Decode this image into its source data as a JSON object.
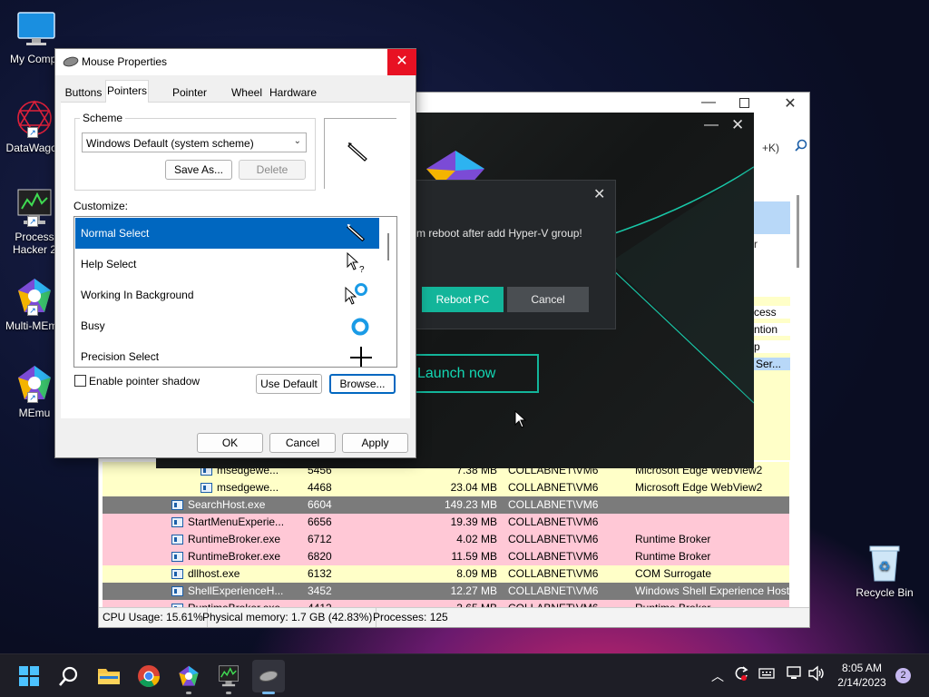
{
  "desktop": {
    "icons": [
      {
        "label": "My Compu"
      },
      {
        "label": "DataWagon"
      },
      {
        "label": "Process Hacker 2"
      },
      {
        "label": "Multi-MEmu"
      },
      {
        "label": "MEmu"
      },
      {
        "label": "Recycle Bin"
      }
    ]
  },
  "process_hacker": {
    "search_hint": "+K)",
    "partial_labels": [
      "r",
      "cess",
      "ntion",
      "p",
      "Ser..."
    ],
    "rows": [
      {
        "name": "msedgewe...",
        "pid": "5456",
        "memory": "7.38 MB",
        "user": "COLLABNET\\VM6",
        "desc": "Microsoft Edge WebView2",
        "bg": "#ffffc8",
        "indent": true
      },
      {
        "name": "msedgewe...",
        "pid": "4468",
        "memory": "23.04 MB",
        "user": "COLLABNET\\VM6",
        "desc": "Microsoft Edge WebView2",
        "bg": "#ffffc8",
        "indent": true
      },
      {
        "name": "SearchHost.exe",
        "pid": "6604",
        "memory": "149.23 MB",
        "user": "COLLABNET\\VM6",
        "desc": "",
        "bg": "#7b7b7b",
        "indent": false
      },
      {
        "name": "StartMenuExperie...",
        "pid": "6656",
        "memory": "19.39 MB",
        "user": "COLLABNET\\VM6",
        "desc": "",
        "bg": "#ffc8d6",
        "indent": false
      },
      {
        "name": "RuntimeBroker.exe",
        "pid": "6712",
        "memory": "4.02 MB",
        "user": "COLLABNET\\VM6",
        "desc": "Runtime Broker",
        "bg": "#ffc8d6",
        "indent": false
      },
      {
        "name": "RuntimeBroker.exe",
        "pid": "6820",
        "memory": "11.59 MB",
        "user": "COLLABNET\\VM6",
        "desc": "Runtime Broker",
        "bg": "#ffc8d6",
        "indent": false
      },
      {
        "name": "dllhost.exe",
        "pid": "6132",
        "memory": "8.09 MB",
        "user": "COLLABNET\\VM6",
        "desc": "COM Surrogate",
        "bg": "#ffffc8",
        "indent": false
      },
      {
        "name": "ShellExperienceH...",
        "pid": "3452",
        "memory": "12.27 MB",
        "user": "COLLABNET\\VM6",
        "desc": "Windows Shell Experience Host",
        "bg": "#7b7b7b",
        "indent": false
      },
      {
        "name": "RuntimeBroker.exe",
        "pid": "4412",
        "memory": "3.65 MB",
        "user": "COLLABNET\\VM6",
        "desc": "Runtime Broker",
        "bg": "#ffc8d6",
        "indent": false
      }
    ],
    "status": {
      "cpu": "CPU Usage: 15.61%",
      "memory": "Physical memory: 1.7 GB (42.83%)",
      "processes": "Processes: 125"
    }
  },
  "memu": {
    "launch_label": "Launch now",
    "dialog": {
      "message": "m reboot after add Hyper-V group!",
      "reboot_label": "Reboot PC",
      "cancel_label": "Cancel"
    }
  },
  "mouse_properties": {
    "title": "Mouse Properties",
    "tabs": [
      "Buttons",
      "Pointers",
      "Pointer Options",
      "Wheel",
      "Hardware"
    ],
    "active_tab": "Pointers",
    "scheme_label": "Scheme",
    "scheme_value": "Windows Default (system scheme)",
    "save_as_label": "Save As...",
    "delete_label": "Delete",
    "customize_label": "Customize:",
    "pointers": [
      {
        "name": "Normal Select",
        "selected": true
      },
      {
        "name": "Help Select",
        "selected": false
      },
      {
        "name": "Working In Background",
        "selected": false
      },
      {
        "name": "Busy",
        "selected": false
      },
      {
        "name": "Precision Select",
        "selected": false
      }
    ],
    "shadow_label": "Enable pointer shadow",
    "shadow_checked": false,
    "use_default_label": "Use Default",
    "browse_label": "Browse...",
    "ok_label": "OK",
    "cancel_label": "Cancel",
    "apply_label": "Apply"
  },
  "taskbar": {
    "time": "8:05 AM",
    "date": "2/14/2023",
    "notification_count": "2"
  },
  "colors": {
    "accent": "#0067c0",
    "memu_teal": "#13b59a",
    "close_red": "#e81123"
  }
}
